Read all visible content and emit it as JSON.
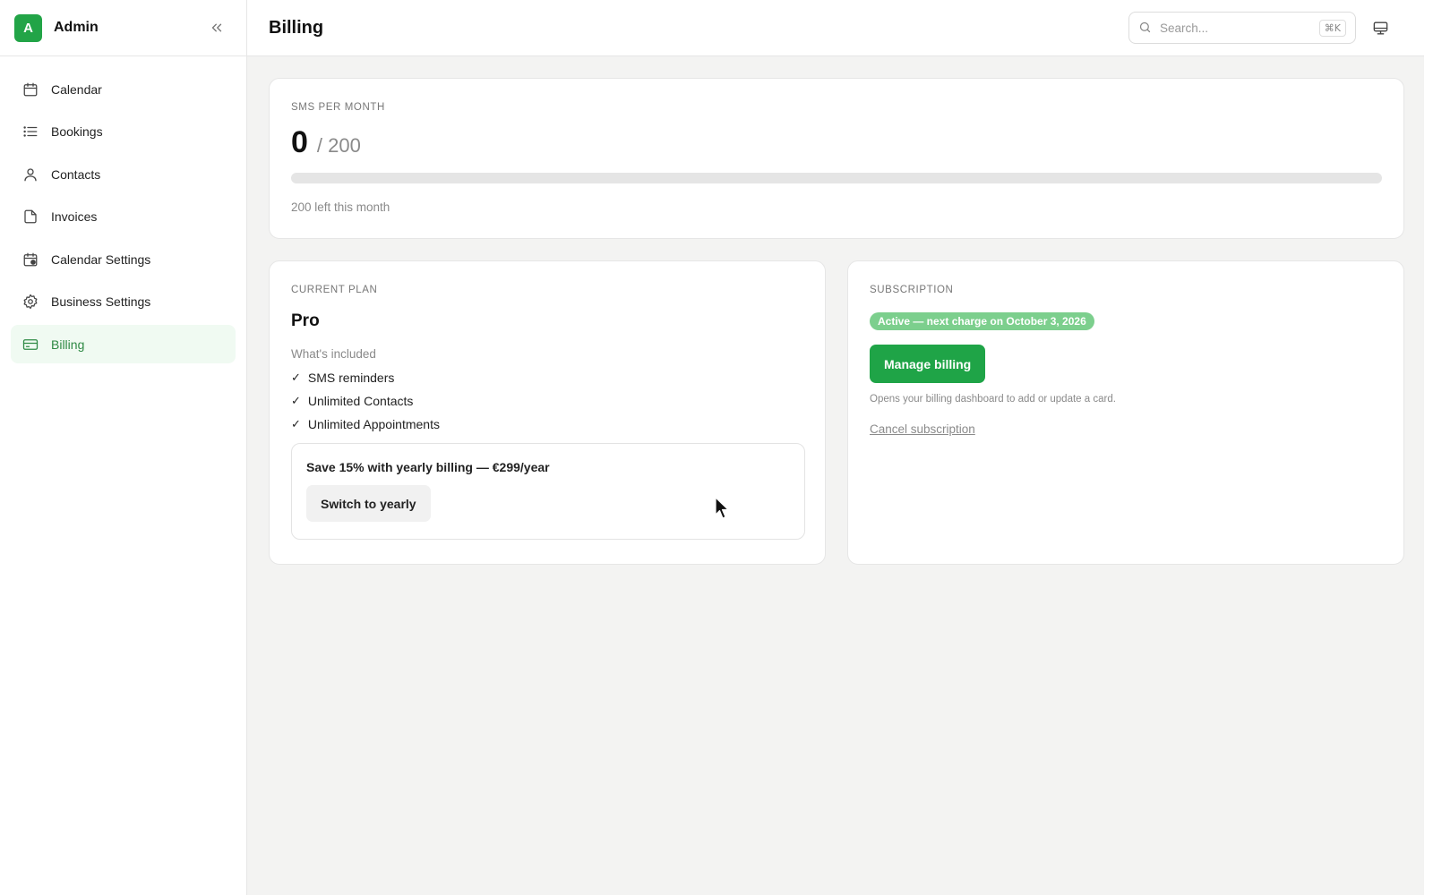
{
  "sidebar": {
    "avatar_letter": "A",
    "app_name": "Admin",
    "items": [
      {
        "label": "Calendar",
        "icon": "calendar-icon"
      },
      {
        "label": "Bookings",
        "icon": "list-icon"
      },
      {
        "label": "Contacts",
        "icon": "user-icon"
      },
      {
        "label": "Invoices",
        "icon": "file-icon"
      },
      {
        "label": "Calendar Settings",
        "icon": "calendar-settings-icon"
      },
      {
        "label": "Business Settings",
        "icon": "gear-icon"
      },
      {
        "label": "Billing",
        "icon": "credit-card-icon",
        "active": true
      }
    ]
  },
  "header": {
    "title": "Billing",
    "search_placeholder": "Search...",
    "search_shortcut": "⌘K"
  },
  "sms": {
    "label": "SMS PER MONTH",
    "used": "0",
    "total": "/ 200",
    "used_fraction": 0,
    "left_text": "200 left this month"
  },
  "plan": {
    "label": "CURRENT PLAN",
    "name": "Pro",
    "included_label": "What's included",
    "features": [
      "SMS reminders",
      "Unlimited Contacts",
      "Unlimited Appointments"
    ],
    "promo_text": "Save 15% with yearly billing — €299/year",
    "switch_label": "Switch to yearly"
  },
  "subscription": {
    "label": "SUBSCRIPTION",
    "status": "Active — next charge on October 3, 2026",
    "manage_label": "Manage billing",
    "manage_hint": "Opens your billing dashboard to add or update a card.",
    "cancel_label": "Cancel subscription"
  },
  "colors": {
    "accent": "#22a447",
    "badge": "#7ccf8d",
    "active_bg": "#f0faf2",
    "active_text": "#2f8a45"
  }
}
